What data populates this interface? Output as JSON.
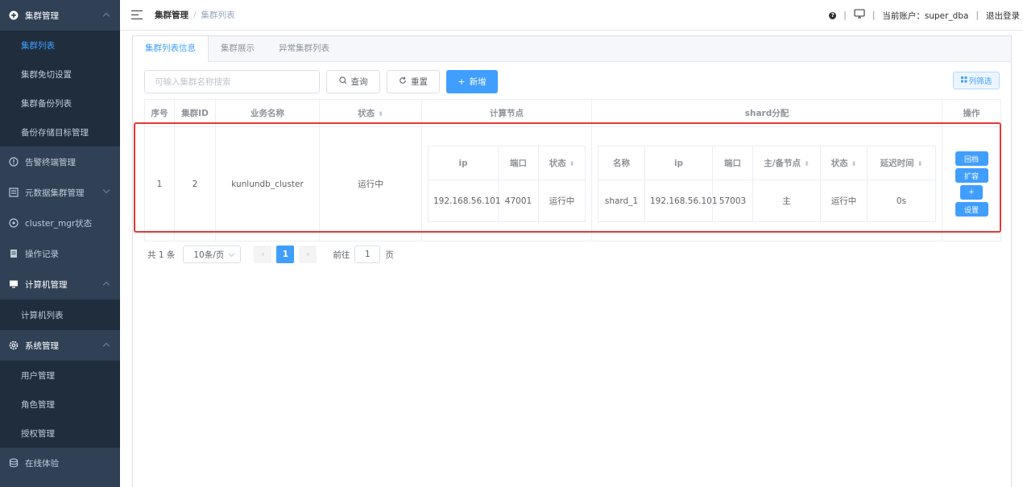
{
  "sidebar": {
    "group1": {
      "label": "集群管理",
      "items": [
        "集群列表",
        "集群免切设置",
        "集群备份列表",
        "备份存储目标管理"
      ]
    },
    "alarm": "告警终端管理",
    "meta": "元数据集群管理",
    "cmgr": "cluster_mgr状态",
    "oplog": "操作记录",
    "machine": {
      "label": "计算机管理",
      "items": [
        "计算机列表"
      ]
    },
    "system": {
      "label": "系统管理",
      "items": [
        "用户管理",
        "角色管理",
        "授权管理"
      ]
    },
    "online": "在线体验"
  },
  "header": {
    "breadcrumb": [
      "集群管理",
      "集群列表"
    ],
    "separator": "/",
    "account_label": "当前账户：super_dba",
    "logout": "退出登录",
    "divider": "|"
  },
  "tabs": [
    "集群列表信息",
    "集群展示",
    "异常集群列表"
  ],
  "toolbar": {
    "search_placeholder": "可输入集群名称搜索",
    "query": "查询",
    "reset": "重置",
    "add": "新增",
    "column_filter": "列筛选"
  },
  "table": {
    "headers": {
      "index": "序号",
      "cluster_id": "集群ID",
      "biz_name": "业务名称",
      "status": "状态",
      "compute": "计算节点",
      "shard": "shard分配",
      "ops": "操作"
    },
    "compute_headers": {
      "ip": "ip",
      "port": "端口",
      "status": "状态"
    },
    "shard_headers": {
      "name": "名称",
      "ip": "ip",
      "port": "端口",
      "role": "主/备节点",
      "status": "状态",
      "delay": "延迟时间"
    },
    "row": {
      "index": "1",
      "cluster_id": "2",
      "biz_name": "kunlundb_cluster",
      "status": "运行中",
      "compute": {
        "ip": "192.168.56.101",
        "port": "47001",
        "status": "运行中"
      },
      "shard": {
        "name": "shard_1",
        "ip": "192.168.56.101",
        "port": "57003",
        "role": "主",
        "status": "运行中",
        "delay": "0s"
      },
      "ops": [
        "回档",
        "扩容",
        "+",
        "设置"
      ]
    }
  },
  "pagination": {
    "total": "共 1 条",
    "page_size": "10条/页",
    "current": "1",
    "goto_prefix": "前往",
    "goto_value": "1",
    "goto_suffix": "页"
  }
}
